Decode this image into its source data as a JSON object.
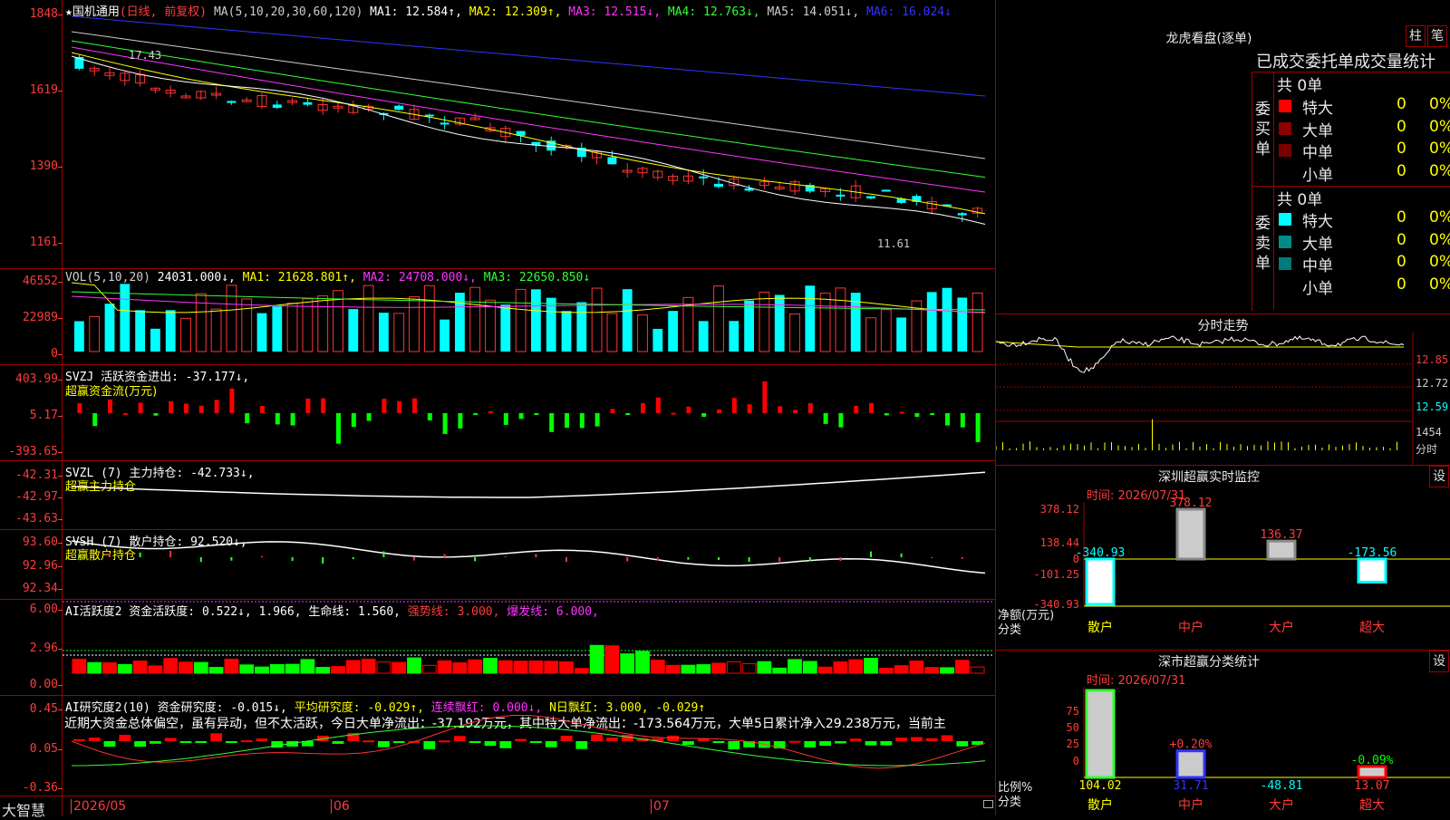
{
  "brand": "大智慧",
  "candle_pane": {
    "legend": [
      {
        "text": "★国机通用",
        "color": "#ffffff"
      },
      {
        "text": "(日线, 前复权)",
        "color": "#ff3b3b"
      },
      {
        "text": " MA(5,10,20,30,60,120)",
        "color": "#cccccc"
      },
      {
        "text": " MA1: 12.584↑,",
        "color": "#ffffff"
      },
      {
        "text": " MA2: 12.309↑,",
        "color": "#ffff00"
      },
      {
        "text": " MA3: 12.515↓,",
        "color": "#ff33ff"
      },
      {
        "text": " MA4: 12.763↓,",
        "color": "#33ff33"
      },
      {
        "text": " MA5: 14.051↓,",
        "color": "#cccccc"
      },
      {
        "text": " MA6: 16.024↓",
        "color": "#3333ff"
      }
    ],
    "yticks": [
      "1848",
      "1619",
      "1390",
      "1161"
    ],
    "annotations": [
      "17.43",
      "11.61"
    ]
  },
  "vol_pane": {
    "legend": [
      {
        "text": "VOL(5,10,20)",
        "color": "#cccccc"
      },
      {
        "text": " 24031.000↓,",
        "color": "#ffffff"
      },
      {
        "text": " MA1: 21628.801↑,",
        "color": "#ffff00"
      },
      {
        "text": " MA2: 24708.000↓,",
        "color": "#ff33ff"
      },
      {
        "text": " MA3: 22650.850↓",
        "color": "#33ff33"
      }
    ],
    "yticks": [
      "46552",
      "22989",
      "0"
    ]
  },
  "svzj_pane": {
    "legend": [
      {
        "text": "SVZJ  活跃资金进出: -37.177↓,",
        "color": "#ffffff"
      }
    ],
    "legend2": "超赢资金流(万元)",
    "yticks": [
      "403.99",
      "5.17",
      "-393.65"
    ]
  },
  "svzl_pane": {
    "legend": [
      {
        "text": "SVZL (7) 主力持仓: -42.733↓,",
        "color": "#ffffff"
      }
    ],
    "legend2": "超赢主力持仓",
    "yticks": [
      "-42.31",
      "-42.97",
      "-43.63"
    ]
  },
  "svsh_pane": {
    "legend": [
      {
        "text": "SVSH (7) 散户持仓: 92.520↓,",
        "color": "#ffffff"
      }
    ],
    "legend2": "超赢散户持仓",
    "yticks": [
      "93.60",
      "92.96",
      "92.34"
    ]
  },
  "ai1_pane": {
    "legend": [
      {
        "text": "AI活跃度2 资金活跃度: 0.522↓, 1.966, 生命线: 1.560,",
        "color": "#ffffff"
      },
      {
        "text": " 强势线: 3.000,",
        "color": "#ff3b3b"
      },
      {
        "text": " 爆发线: 6.000,",
        "color": "#ff33ff"
      }
    ],
    "yticks": [
      "6.00",
      "2.96",
      "0.00"
    ]
  },
  "ai2_pane": {
    "legend": [
      {
        "text": "AI研究度2(10) 资金研究度: -0.015↓,",
        "color": "#ffffff"
      },
      {
        "text": " 平均研究度: -0.029↑,",
        "color": "#ffff00"
      },
      {
        "text": " 连续飘红: 0.000↓,",
        "color": "#ff33ff"
      },
      {
        "text": " N日飘红: 3.000, -0.029↑",
        "color": "#ffff00"
      }
    ],
    "commentary": "近期大资金总体偏空，虽有异动，但不太活跃，今日大单净流出：-37.192万元，其中特大单净流出：-173.564万元，大单5日累计净入29.238万元，当前主",
    "yticks": [
      "0.45",
      "0.05",
      "-0.36"
    ]
  },
  "xaxis": [
    "2026/05",
    "06",
    "07"
  ],
  "longhu": {
    "title": "龙虎看盘(逐单)",
    "btn1": "柱",
    "btn2": "笔",
    "subtitle": "已成交委托单成交量统计",
    "buy_label": "委买单",
    "sell_label": "委卖单",
    "buy_total": "共 0单",
    "sell_total": "共 0单",
    "buy_rows": [
      {
        "name": "特大",
        "v": "0",
        "p": "0%",
        "color": "#ff0000"
      },
      {
        "name": "大单",
        "v": "0",
        "p": "0%",
        "color": "#8b0000"
      },
      {
        "name": "中单",
        "v": "0",
        "p": "0%",
        "color": "#7a0000"
      },
      {
        "name": "小单",
        "v": "0",
        "p": "0%",
        "color": "#000000"
      }
    ],
    "sell_rows": [
      {
        "name": "特大",
        "v": "0",
        "p": "0%",
        "color": "#00ffff"
      },
      {
        "name": "大单",
        "v": "0",
        "p": "0%",
        "color": "#008b8b"
      },
      {
        "name": "中单",
        "v": "0",
        "p": "0%",
        "color": "#007a7a"
      },
      {
        "name": "小单",
        "v": "0",
        "p": "0%",
        "color": "#000000"
      }
    ]
  },
  "fenshi": {
    "title": "分时走势",
    "ylabels": [
      "12.85",
      "12.72",
      "12.59"
    ],
    "vol_label": "1454",
    "vol_label2": "分时"
  },
  "monitor": {
    "title": "深圳超赢实时监控",
    "btn": "设",
    "time": "时间: 2026/07/31",
    "yticks": [
      "378.12",
      "138.44",
      "0",
      "-101.25",
      "-340.93"
    ],
    "ylabel1": "净额(万元)",
    "ylabel2": "分类",
    "categories": [
      "散户",
      "中户",
      "大户",
      "超大"
    ],
    "values": [
      -340.93,
      378.12,
      136.37,
      -173.56
    ],
    "value_labels": [
      "-340.93",
      "378.12",
      "136.37",
      "-173.56"
    ]
  },
  "classify": {
    "title": "深市超赢分类统计",
    "btn": "设",
    "time": "时间: 2026/07/31",
    "yticks": [
      "75",
      "50",
      "25",
      "0"
    ],
    "ylabel1": "比例%",
    "ylabel2": "分类",
    "categories": [
      "散户",
      "中户",
      "大户",
      "超大"
    ],
    "pct_labels": [
      "",
      "+0.20%",
      "",
      "-0.09%"
    ],
    "values": [
      "104.02",
      "31.71",
      "-48.81",
      "13.07"
    ]
  },
  "chart_data": [
    {
      "type": "bar",
      "title": "深圳超赢实时监控",
      "ylabel": "净额(万元)",
      "categories": [
        "散户",
        "中户",
        "大户",
        "超大"
      ],
      "values": [
        -340.93,
        378.12,
        136.37,
        -173.56
      ],
      "ylim": [
        -340.93,
        378.12
      ]
    },
    {
      "type": "bar",
      "title": "深市超赢分类统计",
      "ylabel": "比例%",
      "categories": [
        "散户",
        "中户",
        "大户",
        "超大"
      ],
      "values": [
        104.02,
        31.71,
        -48.81,
        13.07
      ],
      "ylim": [
        0,
        75
      ]
    }
  ]
}
